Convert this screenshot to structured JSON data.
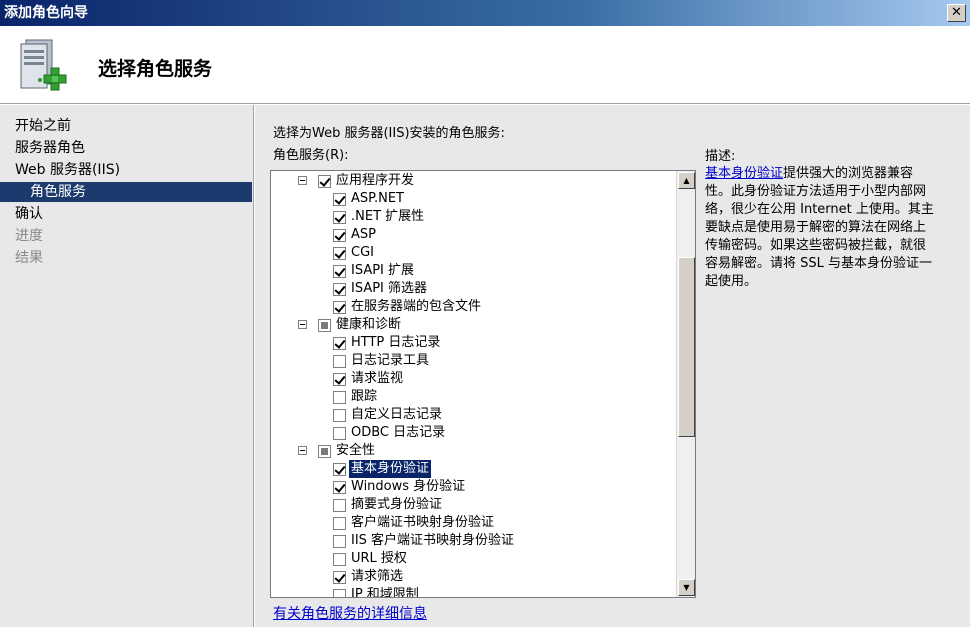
{
  "window": {
    "title": "添加角色向导",
    "close_label": "✕"
  },
  "header": {
    "title": "选择角色服务",
    "icon": "server-add-role-icon"
  },
  "nav": {
    "items": [
      {
        "label": "开始之前",
        "state": "normal"
      },
      {
        "label": "服务器角色",
        "state": "normal"
      },
      {
        "label": "Web 服务器(IIS)",
        "state": "normal"
      },
      {
        "label": "角色服务",
        "state": "selected"
      },
      {
        "label": "确认",
        "state": "normal"
      },
      {
        "label": "进度",
        "state": "disabled"
      },
      {
        "label": "结果",
        "state": "disabled"
      }
    ]
  },
  "main": {
    "instruction": "选择为Web 服务器(IIS)安装的角色服务:",
    "list_label": "角色服务(R):",
    "tree": [
      {
        "label": "应用程序开发",
        "state": "checked",
        "group": true
      },
      {
        "label": "ASP.NET",
        "state": "checked"
      },
      {
        "label": ".NET 扩展性",
        "state": "checked"
      },
      {
        "label": "ASP",
        "state": "checked"
      },
      {
        "label": "CGI",
        "state": "checked"
      },
      {
        "label": "ISAPI 扩展",
        "state": "checked"
      },
      {
        "label": "ISAPI 筛选器",
        "state": "checked"
      },
      {
        "label": "在服务器端的包含文件",
        "state": "checked"
      },
      {
        "label": "健康和诊断",
        "state": "partial",
        "group": true
      },
      {
        "label": "HTTP 日志记录",
        "state": "checked"
      },
      {
        "label": "日志记录工具",
        "state": "unchecked"
      },
      {
        "label": "请求监视",
        "state": "checked"
      },
      {
        "label": "跟踪",
        "state": "unchecked"
      },
      {
        "label": "自定义日志记录",
        "state": "unchecked"
      },
      {
        "label": "ODBC 日志记录",
        "state": "unchecked"
      },
      {
        "label": "安全性",
        "state": "partial",
        "group": true
      },
      {
        "label": "基本身份验证",
        "state": "checked",
        "selected": true
      },
      {
        "label": "Windows 身份验证",
        "state": "checked"
      },
      {
        "label": "摘要式身份验证",
        "state": "unchecked"
      },
      {
        "label": "客户端证书映射身份验证",
        "state": "unchecked"
      },
      {
        "label": "IIS 客户端证书映射身份验证",
        "state": "unchecked"
      },
      {
        "label": "URL 授权",
        "state": "unchecked"
      },
      {
        "label": "请求筛选",
        "state": "checked"
      },
      {
        "label": "IP 和域限制",
        "state": "unchecked"
      }
    ],
    "scroll_up": "▲",
    "scroll_down": "▼",
    "description": {
      "title": "描述:",
      "link_text": "基本身份验证",
      "body": "提供强大的浏览器兼容性。此身份验证方法适用于小型内部网络，很少在公用 Internet 上使用。其主要缺点是使用易于解密的算法在网络上传输密码。如果这些密码被拦截，就很容易解密。请将 SSL 与基本身份验证一起使用。"
    },
    "more_info_link": "有关角色服务的详细信息"
  }
}
